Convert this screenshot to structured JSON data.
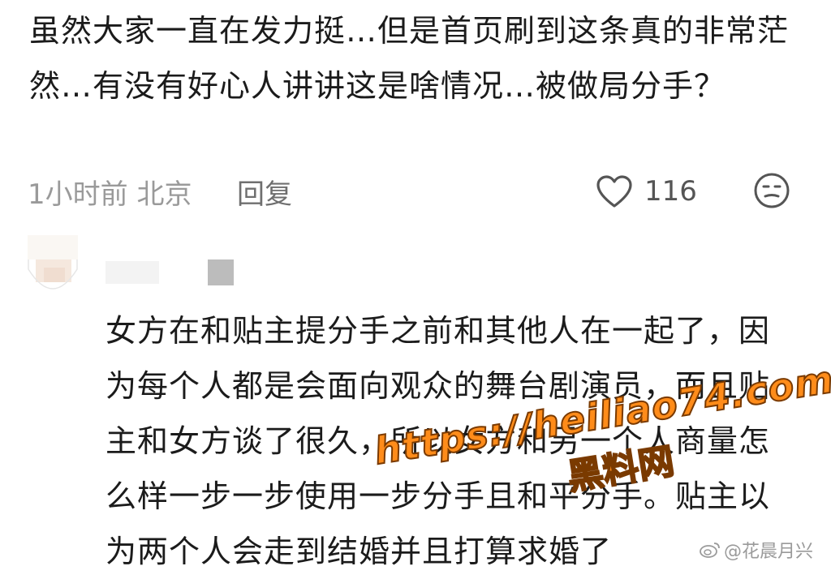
{
  "comment": {
    "text": "虽然大家一直在发力挺…但是首页刷到这条真的非常茫然…有没有好心人讲讲这是啥情况…被做局分手？",
    "time_location": "1小时前 北京",
    "reply_label": "回复",
    "like_count": "116",
    "icons": {
      "like": "heart-outline-icon",
      "emoji": "neutral-face-icon"
    }
  },
  "reply": {
    "text": "女方在和贴主提分手之前和其他人在一起了，因为每个人都是会面向观众的舞台剧演员，而且贴主和女方谈了很久，所以女方和另一个人商量怎么样一步一步使用一步分手且和平分手。贴主以为两个人会走到结婚并且打算求婚了"
  },
  "watermark": {
    "url": "https://heiliao74.com",
    "cn": "黑料网"
  },
  "credit": "@花晨月兴",
  "colors": {
    "text": "#1b1b1b",
    "meta": "#9a9a9a",
    "watermark": "#ff8c1a"
  }
}
